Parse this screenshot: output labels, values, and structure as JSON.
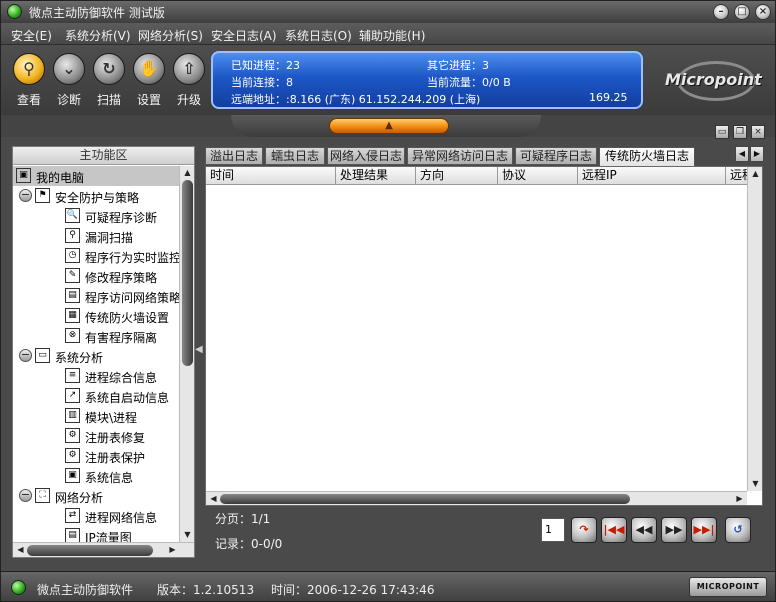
{
  "window": {
    "title": "微点主动防御软件  测试版"
  },
  "menu": [
    "安全(E)",
    "系统分析(V)",
    "网络分析(S)",
    "安全日志(A)",
    "系统日志(O)",
    "辅助功能(H)"
  ],
  "toolbar": [
    {
      "label": "查看",
      "icon": "magnifier-icon",
      "active": true
    },
    {
      "label": "诊断",
      "icon": "diagnose-icon",
      "active": false
    },
    {
      "label": "扫描",
      "icon": "scan-icon",
      "active": false
    },
    {
      "label": "设置",
      "icon": "settings-hand-icon",
      "active": false
    },
    {
      "label": "升级",
      "icon": "upgrade-arrow-icon",
      "active": false
    }
  ],
  "info": {
    "known_processes": "已知进程：23",
    "other_processes": "其它进程：3",
    "current_connections": "当前连接：8",
    "current_traffic": "当前流量：0/0 B",
    "remote_address": "远端地址：:8.166 (广东)   61.152.244.209 (上海)",
    "remote_value": "169.25"
  },
  "logo": {
    "text": "Micropoint"
  },
  "left_panel": {
    "header": "主功能区",
    "tree": [
      {
        "label": "我的电脑",
        "level": 0,
        "expander": "",
        "icon": "computer-icon",
        "selected": true
      },
      {
        "label": "安全防护与策略",
        "level": 1,
        "expander": "−",
        "icon": "shield-flag-icon",
        "selected": false
      },
      {
        "label": "可疑程序诊断",
        "level": 2,
        "expander": "",
        "icon": "doc-magnifier-icon",
        "selected": false
      },
      {
        "label": "漏洞扫描",
        "level": 2,
        "expander": "",
        "icon": "magnifier-icon",
        "selected": false
      },
      {
        "label": "程序行为实时监控策略",
        "level": 2,
        "expander": "",
        "icon": "clock-monitor-icon",
        "selected": false
      },
      {
        "label": "修改程序策略",
        "level": 2,
        "expander": "",
        "icon": "edit-doc-icon",
        "selected": false
      },
      {
        "label": "程序访问网络策略",
        "level": 2,
        "expander": "",
        "icon": "window-icon",
        "selected": false
      },
      {
        "label": "传统防火墙设置",
        "level": 2,
        "expander": "",
        "icon": "firewall-icon",
        "selected": false
      },
      {
        "label": "有害程序隔离",
        "level": 2,
        "expander": "",
        "icon": "isolate-icon",
        "selected": false
      },
      {
        "label": "系统分析",
        "level": 1,
        "expander": "−",
        "icon": "monitor-icon",
        "selected": false
      },
      {
        "label": "进程综合信息",
        "level": 2,
        "expander": "",
        "icon": "process-info-icon",
        "selected": false
      },
      {
        "label": "系统自启动信息",
        "level": 2,
        "expander": "",
        "icon": "startup-icon",
        "selected": false
      },
      {
        "label": "模块\\进程",
        "level": 2,
        "expander": "",
        "icon": "module-icon",
        "selected": false
      },
      {
        "label": "注册表修复",
        "level": 2,
        "expander": "",
        "icon": "registry-repair-icon",
        "selected": false
      },
      {
        "label": "注册表保护",
        "level": 2,
        "expander": "",
        "icon": "registry-protect-icon",
        "selected": false
      },
      {
        "label": "系统信息",
        "level": 2,
        "expander": "",
        "icon": "system-info-icon",
        "selected": false
      },
      {
        "label": "网络分析",
        "level": 1,
        "expander": "−",
        "icon": "network-icon",
        "selected": false
      },
      {
        "label": "进程网络信息",
        "level": 2,
        "expander": "",
        "icon": "process-network-icon",
        "selected": false
      },
      {
        "label": "IP流量图",
        "level": 2,
        "expander": "",
        "icon": "ip-traffic-icon",
        "selected": false
      }
    ]
  },
  "tabs": [
    {
      "label": "溢出日志",
      "active": false
    },
    {
      "label": "蠕虫日志",
      "active": false
    },
    {
      "label": "网络入侵日志",
      "active": false
    },
    {
      "label": "异常网络访问日志",
      "active": false
    },
    {
      "label": "可疑程序日志",
      "active": false
    },
    {
      "label": "传统防火墙日志",
      "active": true
    }
  ],
  "grid": {
    "columns": [
      "时间",
      "处理结果",
      "方向",
      "协议",
      "远程IP",
      "远程"
    ]
  },
  "pager": {
    "page_label": "分页：1/1",
    "records_label": "记录：0-0/0",
    "page_value": "1"
  },
  "status": {
    "app_name": "微点主动防御软件",
    "version": "版本：1.2.10513",
    "time": "时间：2006-12-26 17:43:46",
    "brand": "MICROPOINT"
  }
}
